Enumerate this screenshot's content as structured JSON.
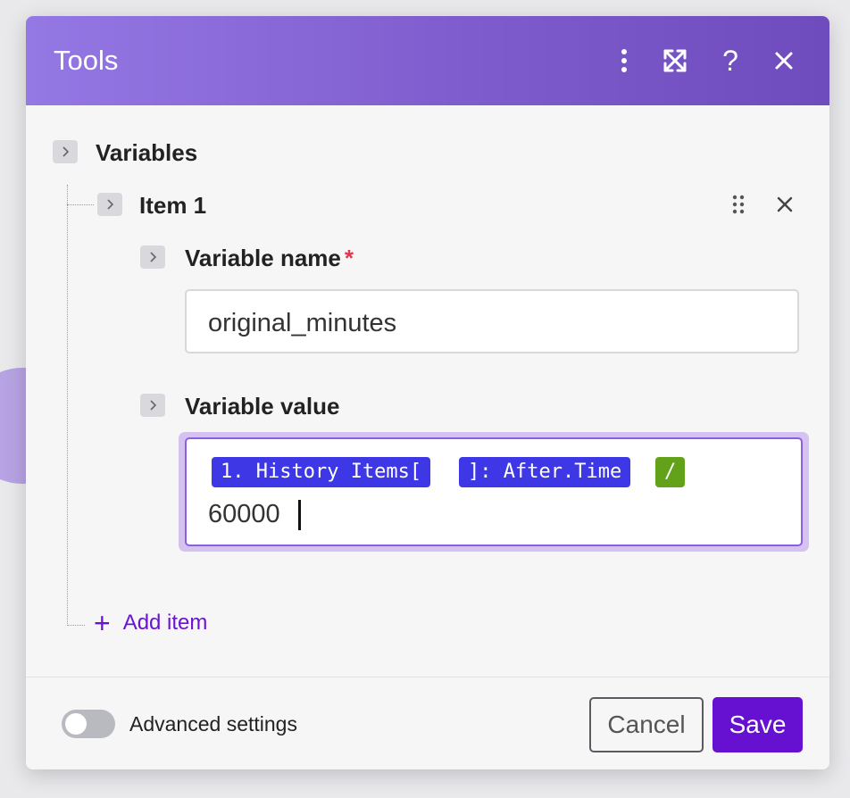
{
  "dialog": {
    "title": "Tools",
    "header_icons": [
      "more-vertical-icon",
      "expand-icon",
      "help-icon",
      "close-icon"
    ],
    "header_help_glyph": "?"
  },
  "variables": {
    "label": "Variables",
    "item": {
      "label": "Item 1",
      "name_field": {
        "label": "Variable name",
        "required_mark": "*",
        "value": "original_minutes"
      },
      "value_field": {
        "label": "Variable value",
        "pills": [
          {
            "text": "1. History Items[",
            "color": "#3d37e6"
          },
          {
            "text": "]: After.Time",
            "color": "#3d37e6"
          },
          {
            "text": "/",
            "color": "#62a21b"
          }
        ],
        "text": "60000"
      }
    },
    "add_item_glyph": "+",
    "add_item_label": "Add item"
  },
  "footer": {
    "advanced_settings_label": "Advanced settings",
    "advanced_settings_enabled": false,
    "cancel_label": "Cancel",
    "save_label": "Save"
  },
  "colors": {
    "header_gradient_start": "#9478e4",
    "header_gradient_end": "#6e4cbd",
    "accent": "#6610d1",
    "pill_blue": "#3d37e6",
    "pill_green": "#62a21b",
    "required": "#e0364f"
  }
}
